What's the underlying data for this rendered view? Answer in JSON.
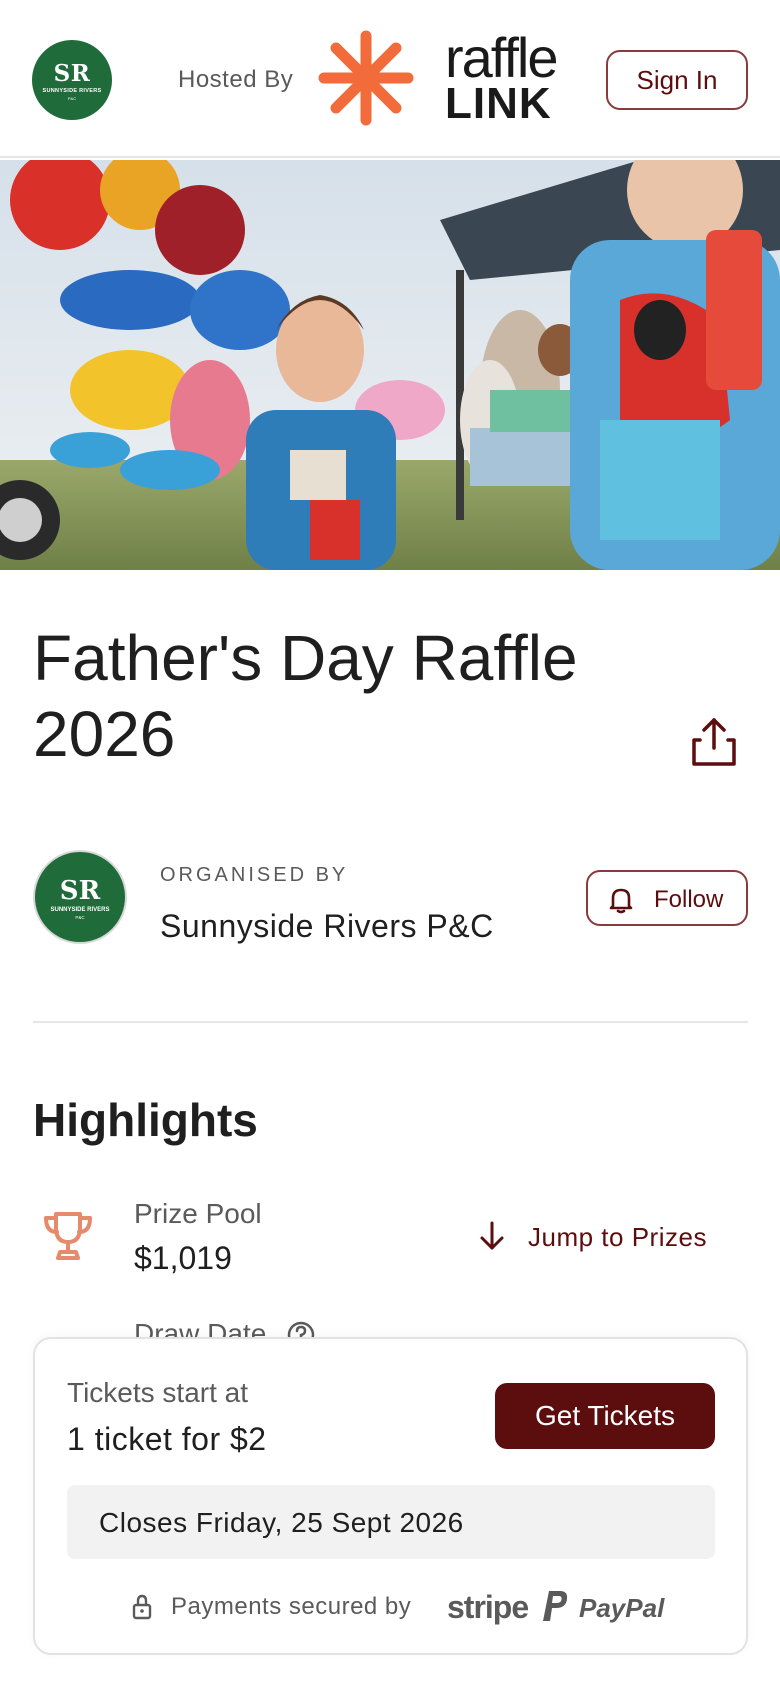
{
  "header": {
    "host_logo": {
      "monogram": "SR",
      "line1": "SUNNYSIDE RIVERS",
      "line2": "P&C"
    },
    "hosted_by": "Hosted By",
    "brand": {
      "word1": "raffle",
      "word2": "LINK",
      "star_color": "#f26b3a"
    },
    "sign_in": "Sign In"
  },
  "hero": {
    "alt": "Children holding lollies at a fair with colourful balloons"
  },
  "raffle": {
    "title": "Father's Day Raffle 2026"
  },
  "organiser": {
    "logo": {
      "monogram": "SR",
      "line1": "SUNNYSIDE RIVERS",
      "line2": "P&C"
    },
    "label": "ORGANISED BY",
    "name": "Sunnyside Rivers P&C",
    "follow": "Follow"
  },
  "highlights": {
    "title": "Highlights",
    "prize_pool_label": "Prize Pool",
    "prize_pool_value": "$1,019",
    "jump_to_prizes": "Jump to Prizes",
    "draw_date_label": "Draw Date"
  },
  "ticket_card": {
    "start_label": "Tickets start at",
    "start_value": "1 ticket for $2",
    "cta": "Get Tickets",
    "closes": "Closes Friday, 25 Sept 2026",
    "payments_label": "Payments secured by",
    "stripe": "stripe",
    "paypal": "PayPal"
  },
  "colors": {
    "brand_maroon": "#5c0d0d",
    "org_green": "#1f6b3a",
    "accent_orange": "#f26b3a"
  }
}
